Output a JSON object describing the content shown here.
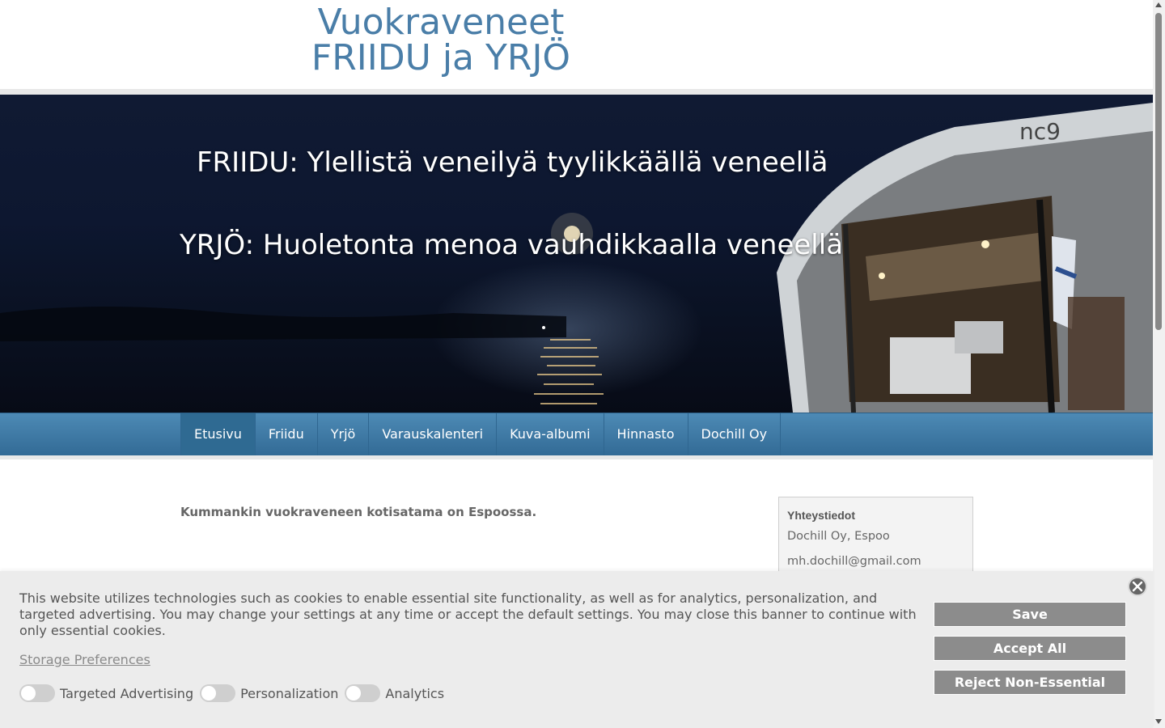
{
  "header": {
    "title_line1": "Vuokraveneet",
    "title_line2": "FRIIDU ja YRJÖ"
  },
  "hero": {
    "line1": "FRIIDU: Ylellistä veneilyä tyylikkäällä veneellä",
    "line2": "YRJÖ: Huoletonta menoa vauhdikkaalla veneellä"
  },
  "nav": {
    "items": [
      {
        "label": "Etusivu",
        "active": true
      },
      {
        "label": "Friidu"
      },
      {
        "label": "Yrjö"
      },
      {
        "label": "Varauskalenteri"
      },
      {
        "label": "Kuva-albumi"
      },
      {
        "label": "Hinnasto"
      },
      {
        "label": "Dochill Oy"
      }
    ]
  },
  "main": {
    "intro": "Kummankin vuokraveneen kotisatama on Espoossa."
  },
  "sidebar": {
    "contact_title": "Yhteystiedot",
    "contact_company": "Dochill Oy, Espoo",
    "contact_email": "mh.dochill@gmail.com"
  },
  "cookie_banner": {
    "text": "This website utilizes technologies such as cookies to enable essential site functionality, as well as for analytics, personalization, and targeted advertising. You may change your settings at any time or accept the default settings. You may close this banner to continue with only essential cookies.",
    "storage_link": "Storage Preferences",
    "toggles": [
      {
        "label": "Targeted Advertising",
        "on": false
      },
      {
        "label": "Personalization",
        "on": false
      },
      {
        "label": "Analytics",
        "on": false
      }
    ],
    "buttons": {
      "save": "Save",
      "accept_all": "Accept All",
      "reject": "Reject Non-Essential"
    }
  },
  "colors": {
    "title": "#4a7ea8",
    "nav": "#3a78a3",
    "banner_button": "#8c8c8c"
  }
}
